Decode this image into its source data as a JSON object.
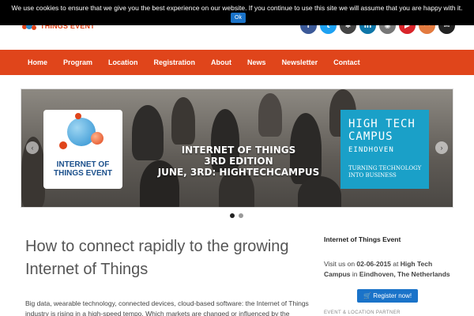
{
  "cookie": {
    "message": "We use cookies to ensure that we give you the best experience on our website. If you continue to use this site we will assume that you are happy with it.",
    "ok_label": "Ok"
  },
  "header": {
    "logo_text": "THINGS EVENT",
    "social_icons": [
      {
        "name": "facebook-icon",
        "glyph": "f",
        "color": "#3b5998"
      },
      {
        "name": "twitter-icon",
        "glyph": "t",
        "color": "#1da1f2"
      },
      {
        "name": "flickr-icon",
        "glyph": "✱",
        "color": "#444444"
      },
      {
        "name": "linkedin-icon",
        "glyph": "in",
        "color": "#0e76a8"
      },
      {
        "name": "instagram-icon",
        "glyph": "◉",
        "color": "#777777"
      },
      {
        "name": "youtube-icon",
        "glyph": "▶",
        "color": "#d9252a"
      },
      {
        "name": "rss-icon",
        "glyph": "◠",
        "color": "#e37b40"
      },
      {
        "name": "mail-icon",
        "glyph": "✉",
        "color": "#222222"
      }
    ]
  },
  "nav": {
    "items": [
      "Home",
      "Program",
      "Location",
      "Registration",
      "About",
      "News",
      "Newsletter",
      "Contact"
    ]
  },
  "slider": {
    "overlay_line1": "INTERNET OF THINGS",
    "overlay_line2": "3RD EDITION",
    "overlay_line3": "JUNE, 3RD: HIGHTECHCAMPUS",
    "badge_line1": "INTERNET OF",
    "badge_line2": "THINGS EVENT",
    "htc_title1": "HIGH TECH",
    "htc_title2": "CAMPUS",
    "htc_sub": "EINDHOVEN",
    "htc_tag": "TURNING TECHNOLOGY INTO BUSINESS",
    "prev_glyph": "‹",
    "next_glyph": "›"
  },
  "article": {
    "title": "How to connect rapidly to the growing Internet of Things",
    "body": "Big data, wearable technology, connected devices, cloud-based software: the Internet of Things industry is rising in a high-speed tempo. Which markets are changed or influenced by the growing IoT? How to secure the cloud? And what developments can we expect in"
  },
  "sidebar": {
    "heading": "Internet of Things Event",
    "visit_prefix": "Visit us on ",
    "visit_date": "02-06-2015",
    "visit_at": " at ",
    "visit_place": "High Tech Campus",
    "visit_in": " in ",
    "visit_city": "Eindhoven, The Netherlands",
    "register_label": "Register now!",
    "register_icon": "🛒",
    "partner_heading": "EVENT & LOCATION PARTNER"
  },
  "colors": {
    "brand_orange": "#e0451b",
    "button_blue": "#1a73c9",
    "campus_blue": "#1aa0c8"
  }
}
